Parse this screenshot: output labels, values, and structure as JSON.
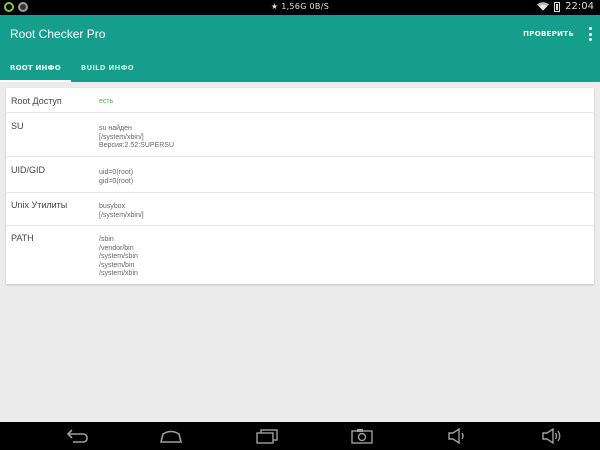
{
  "status": {
    "center_text": "★ 1,56G  0B/S",
    "time": "22:04"
  },
  "app": {
    "title": "Root Checker Pro",
    "verify_label": "ПРОВЕРИТЬ",
    "tabs": [
      {
        "label": "ROOT ИНФО",
        "active": true
      },
      {
        "label": "BUILD ИНФО",
        "active": false
      }
    ],
    "accent": "#169e8c"
  },
  "rows": [
    {
      "key": "Root Доступ",
      "lines": [
        "есть"
      ]
    },
    {
      "key": "SU",
      "lines": [
        "su найден",
        "[/system/xbin/]",
        "Версия:2.52:SUPERSU"
      ]
    },
    {
      "key": "UID/GID",
      "lines": [
        "uid=0(root)",
        "gid=0(root)"
      ]
    },
    {
      "key": "Unix Утилиты",
      "lines": [
        "busybox",
        "[/system/xbin/]"
      ]
    },
    {
      "key": "PATH",
      "lines": [
        "/sbin",
        "/vendor/bin",
        "/system/sbin",
        "/system/bin",
        "/system/xbin"
      ]
    }
  ],
  "icons": {
    "status_left": [
      "circle-icon",
      "android-icon"
    ],
    "status_right": [
      "wifi-icon",
      "battery-icon"
    ],
    "nav": [
      "back-icon",
      "home-icon",
      "recents-icon",
      "screenshot-icon",
      "volume-down-icon",
      "volume-up-icon"
    ]
  }
}
